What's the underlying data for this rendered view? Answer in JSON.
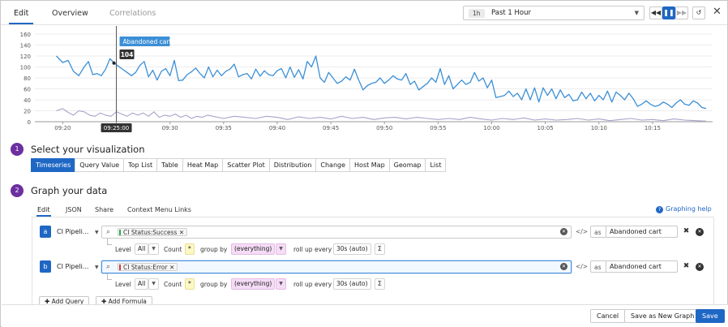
{
  "tabs": [
    {
      "label": "Edit",
      "state": "active"
    },
    {
      "label": "Overview",
      "state": "normal"
    },
    {
      "label": "Correlations",
      "state": "disabled"
    }
  ],
  "time": {
    "badge": "1h",
    "label": "Past 1 Hour"
  },
  "controls": {
    "rewind": "◀◀",
    "pause": "❚❚",
    "forward": "▶▶",
    "reset": "↺",
    "close": "✕"
  },
  "chart_data": {
    "type": "line",
    "xlabel": "",
    "ylabel": "",
    "ylim": [
      0,
      160
    ],
    "yticks": [
      0,
      20,
      40,
      60,
      80,
      100,
      120,
      140,
      160
    ],
    "xticks": [
      "09:20",
      "09:25",
      "09:30",
      "09:35",
      "09:40",
      "09:45",
      "09:50",
      "09:55",
      "10:00",
      "10:05",
      "10:10",
      "10:15"
    ],
    "x_range_minutes": [
      -2.6,
      60.6
    ],
    "grid": true,
    "cursor": {
      "x_minutes": 5,
      "time_label": "09:25:00",
      "series_label": "Abandoned cart",
      "value": 104
    },
    "series": [
      {
        "name": "Abandoned cart",
        "color": "#3b8fd6",
        "x_minutes": [
          -0.6,
          0.0,
          0.5,
          1.0,
          1.5,
          2.0,
          2.4,
          2.8,
          3.2,
          3.6,
          4.0,
          4.4,
          5.0,
          5.5,
          6.0,
          6.4,
          6.8,
          7.2,
          7.6,
          8.0,
          8.4,
          8.8,
          9.2,
          9.6,
          10.0,
          10.4,
          10.8,
          11.2,
          11.6,
          12.0,
          12.4,
          12.8,
          13.2,
          13.6,
          14.0,
          14.4,
          14.8,
          15.2,
          15.6,
          16.0,
          16.4,
          16.8,
          17.2,
          17.6,
          18.0,
          18.4,
          18.8,
          19.2,
          19.6,
          20.0,
          20.4,
          20.8,
          21.2,
          21.6,
          22.0,
          22.4,
          22.8,
          23.2,
          23.6,
          24.0,
          24.4,
          24.8,
          25.2,
          25.6,
          26.0,
          26.4,
          26.8,
          27.2,
          27.6,
          28.0,
          28.4,
          28.8,
          29.2,
          29.6,
          30.0,
          30.4,
          30.8,
          31.2,
          31.6,
          32.0,
          32.4,
          32.8,
          33.2,
          33.6,
          34.0,
          34.4,
          34.8,
          35.2,
          35.6,
          36.0,
          36.4,
          36.8,
          37.2,
          37.6,
          38.0,
          38.4,
          38.8,
          39.2,
          39.6,
          40.0,
          40.4,
          40.8,
          41.2,
          41.6,
          42.0,
          42.4,
          42.8,
          43.2,
          43.6,
          44.0,
          44.4,
          44.8,
          45.2,
          45.6,
          46.0,
          46.4,
          46.8,
          47.2,
          47.6,
          48.0,
          48.4,
          48.8,
          49.2,
          49.6,
          50.0,
          50.4,
          50.8,
          51.2,
          51.6,
          52.0,
          52.4,
          52.8,
          53.2,
          53.6,
          54.0,
          54.4,
          54.8,
          55.2,
          55.6,
          56.0,
          56.4,
          56.8,
          57.2,
          57.6,
          58.0,
          58.4,
          58.8,
          59.2,
          59.6,
          60.0
        ],
        "values": [
          120,
          108,
          112,
          92,
          84,
          100,
          110,
          86,
          88,
          84,
          96,
          115,
          104,
          97,
          90,
          84,
          90,
          103,
          110,
          82,
          94,
          76,
          92,
          97,
          84,
          112,
          75,
          76,
          86,
          91,
          98,
          88,
          80,
          100,
          82,
          94,
          84,
          92,
          96,
          105,
          82,
          86,
          88,
          78,
          96,
          83,
          93,
          86,
          84,
          93,
          97,
          80,
          100,
          81,
          95,
          78,
          110,
          100,
          120,
          80,
          72,
          90,
          80,
          70,
          74,
          82,
          76,
          96,
          76,
          58,
          66,
          70,
          72,
          80,
          70,
          76,
          84,
          78,
          76,
          88,
          68,
          74,
          58,
          64,
          70,
          80,
          72,
          97,
          68,
          84,
          60,
          68,
          76,
          68,
          72,
          90,
          74,
          80,
          62,
          76,
          44,
          46,
          48,
          56,
          46,
          52,
          40,
          60,
          40,
          62,
          36,
          62,
          48,
          60,
          42,
          58,
          44,
          50,
          38,
          40,
          54,
          42,
          52,
          38,
          48,
          40,
          56,
          36,
          54,
          48,
          40,
          52,
          42,
          28,
          32,
          38,
          32,
          28,
          30,
          36,
          32,
          26,
          34,
          40,
          32,
          30,
          38,
          34,
          26,
          24,
          34,
          22,
          26,
          20,
          22,
          30,
          24,
          24,
          12,
          8
        ]
      },
      {
        "name": "CI Status:Error",
        "color": "#a7a4c9",
        "x_minutes": [
          -0.6,
          0.0,
          0.5,
          1.0,
          1.5,
          2.0,
          2.5,
          3.0,
          3.5,
          4.0,
          4.5,
          5.0,
          5.5,
          6.0,
          6.5,
          7.0,
          7.5,
          8.0,
          8.5,
          9.0,
          9.5,
          10.0,
          10.5,
          11.0,
          11.5,
          12.0,
          12.5,
          13.0,
          13.5,
          14.0,
          15.0,
          16.0,
          17.0,
          18.0,
          19.0,
          20.0,
          21.0,
          22.0,
          23.0,
          24.0,
          25.0,
          26.0,
          27.0,
          28.0,
          29.0,
          30.0,
          31.0,
          32.0,
          33.0,
          34.0,
          35.0,
          36.0,
          37.0,
          38.0,
          39.0,
          40.0,
          41.0,
          42.0,
          43.0,
          44.0,
          45.0,
          46.0,
          47.0,
          48.0,
          49.0,
          50.0,
          51.0,
          52.0,
          53.0,
          54.0,
          55.0,
          56.0,
          57.0,
          58.0,
          59.0,
          60.0
        ],
        "values": [
          20,
          24,
          17,
          12,
          20,
          18,
          12,
          10,
          16,
          12,
          10,
          18,
          14,
          10,
          16,
          12,
          16,
          10,
          18,
          8,
          12,
          10,
          14,
          8,
          12,
          6,
          10,
          8,
          12,
          10,
          6,
          10,
          8,
          6,
          10,
          8,
          4,
          9,
          6,
          8,
          5,
          10,
          6,
          8,
          4,
          7,
          8,
          5,
          8,
          6,
          4,
          6,
          4,
          8,
          5,
          3,
          6,
          4,
          7,
          3,
          5,
          3,
          4,
          6,
          3,
          5,
          2,
          4,
          6,
          3,
          4,
          2,
          5,
          3,
          2,
          1
        ]
      }
    ]
  },
  "sections": {
    "visualization": {
      "step": "1",
      "title": "Select your visualization"
    },
    "graph": {
      "step": "2",
      "title": "Graph your data"
    }
  },
  "viz_types": [
    "Timeseries",
    "Query Value",
    "Top List",
    "Table",
    "Heat Map",
    "Scatter Plot",
    "Distribution",
    "Change",
    "Host Map",
    "Geomap",
    "List"
  ],
  "viz_active": "Timeseries",
  "editor_tabs": [
    "Edit",
    "JSON",
    "Share",
    "Context Menu Links"
  ],
  "help_link": "Graphing help",
  "queries": [
    {
      "letter": "a",
      "source": "CI Pipeli...",
      "chip": "CI Status:Success",
      "chip_color": "#2ea84a",
      "alias_label": "as",
      "alias": "Abandoned cart",
      "level_label": "Level",
      "level_value": "All",
      "count_label": "Count",
      "count_value": "*",
      "groupby_label": "group by",
      "groupby_value": "(everything)",
      "rollup_label": "roll up every",
      "rollup_value": "30s (auto)",
      "sigma": "Σ"
    },
    {
      "letter": "b",
      "source": "CI Pipeli...",
      "chip": "CI Status:Error",
      "chip_color": "#d9353f",
      "alias_label": "as",
      "alias": "Abandoned cart",
      "level_label": "Level",
      "level_value": "All",
      "count_label": "Count",
      "count_value": "*",
      "groupby_label": "group by",
      "groupby_value": "(everything)",
      "rollup_label": "roll up every",
      "rollup_value": "30s (auto)",
      "sigma": "Σ"
    }
  ],
  "add_query": "Add Query",
  "add_formula": "Add Formula",
  "footer": {
    "cancel": "Cancel",
    "save_new": "Save as New Graph",
    "save": "Save"
  }
}
